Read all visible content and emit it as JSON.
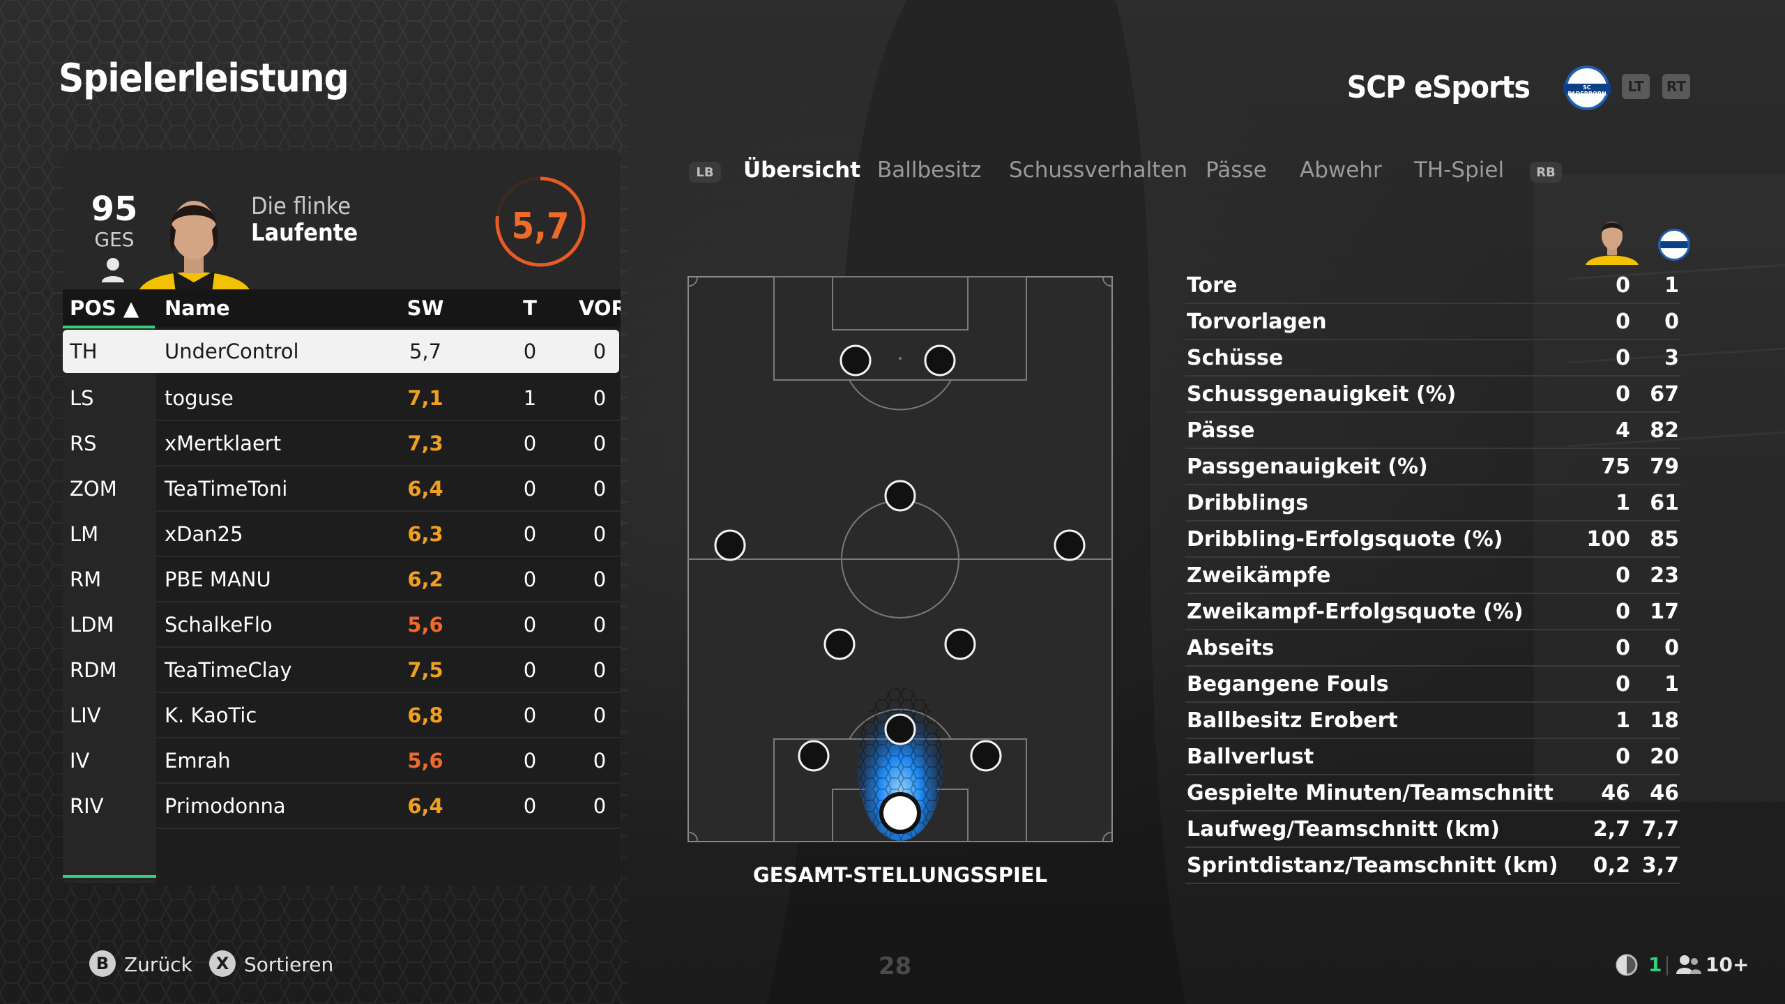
{
  "page": {
    "title": "Spielerleistung",
    "team_name": "SCP eSports",
    "page_number": "28"
  },
  "header": {
    "lt_label": "LT",
    "rt_label": "RT",
    "crest_text": "SC PADERBORN 07"
  },
  "player_card": {
    "rating": "95",
    "rating_label": "GES",
    "nickname_line1": "Die flinke",
    "nickname_line2": "Laufente",
    "match_rating": "5,7"
  },
  "table": {
    "columns": [
      "POS ▲",
      "Name",
      "SW",
      "T",
      "VOR"
    ],
    "rows": [
      {
        "pos": "TH",
        "name": "UnderControl",
        "sw": "5,7",
        "t": "0",
        "vor": "0",
        "selected": true
      },
      {
        "pos": "LS",
        "name": "toguse",
        "sw": "7,1",
        "t": "1",
        "vor": "0",
        "color": "#f0a020"
      },
      {
        "pos": "RS",
        "name": "xMertklaert",
        "sw": "7,3",
        "t": "0",
        "vor": "0",
        "color": "#f0a020"
      },
      {
        "pos": "ZOM",
        "name": "TeaTimeToni",
        "sw": "6,4",
        "t": "0",
        "vor": "0",
        "color": "#f0a020"
      },
      {
        "pos": "LM",
        "name": "xDan25",
        "sw": "6,3",
        "t": "0",
        "vor": "0",
        "color": "#f0a020"
      },
      {
        "pos": "RM",
        "name": "PBE MANU",
        "sw": "6,2",
        "t": "0",
        "vor": "0",
        "color": "#f0a020"
      },
      {
        "pos": "LDM",
        "name": "SchalkeFlo",
        "sw": "5,6",
        "t": "0",
        "vor": "0",
        "color": "#f06a2a"
      },
      {
        "pos": "RDM",
        "name": "TeaTimeClay",
        "sw": "7,5",
        "t": "0",
        "vor": "0",
        "color": "#f0a020"
      },
      {
        "pos": "LIV",
        "name": "K. KaoTic",
        "sw": "6,8",
        "t": "0",
        "vor": "0",
        "color": "#f0a020"
      },
      {
        "pos": "IV",
        "name": "Emrah",
        "sw": "5,6",
        "t": "0",
        "vor": "0",
        "color": "#f06a2a"
      },
      {
        "pos": "RIV",
        "name": "Primodonna",
        "sw": "6,4",
        "t": "0",
        "vor": "0",
        "color": "#f0a020"
      }
    ]
  },
  "tabs": {
    "lb": "LB",
    "rb": "RB",
    "items": [
      "Übersicht",
      "Ballbesitz",
      "Schussverhalten",
      "Pässe",
      "Abwehr",
      "TH-Spiel"
    ],
    "active": "Übersicht"
  },
  "pitch": {
    "label": "GESAMT-STELLUNGSSPIEL"
  },
  "stats": [
    {
      "label": "Tore",
      "player": "0",
      "team": "1"
    },
    {
      "label": "Torvorlagen",
      "player": "0",
      "team": "0"
    },
    {
      "label": "Schüsse",
      "player": "0",
      "team": "3"
    },
    {
      "label": "Schussgenauigkeit (%)",
      "player": "0",
      "team": "67"
    },
    {
      "label": "Pässe",
      "player": "4",
      "team": "82"
    },
    {
      "label": "Passgenauigkeit (%)",
      "player": "75",
      "team": "79"
    },
    {
      "label": "Dribblings",
      "player": "1",
      "team": "61"
    },
    {
      "label": "Dribbling-Erfolgsquote (%)",
      "player": "100",
      "team": "85"
    },
    {
      "label": "Zweikämpfe",
      "player": "0",
      "team": "23"
    },
    {
      "label": "Zweikampf-Erfolgsquote (%)",
      "player": "0",
      "team": "17"
    },
    {
      "label": "Abseits",
      "player": "0",
      "team": "0"
    },
    {
      "label": "Begangene Fouls",
      "player": "0",
      "team": "1"
    },
    {
      "label": "Ballbesitz Erobert",
      "player": "1",
      "team": "18"
    },
    {
      "label": "Ballverlust",
      "player": "0",
      "team": "20"
    },
    {
      "label": "Gespielte Minuten/Teamschnitt",
      "player": "46",
      "team": "46"
    },
    {
      "label": "Laufweg/Teamschnitt (km)",
      "player": "2,7",
      "team": "7,7"
    },
    {
      "label": "Sprintdistanz/Teamschnitt (km)",
      "player": "0,2",
      "team": "3,7"
    }
  ],
  "footer": {
    "back_key": "B",
    "back_label": "Zurück",
    "sort_key": "X",
    "sort_label": "Sortieren",
    "online_count": "1",
    "party_count": "10+"
  },
  "colors": {
    "accent_green": "#34d17a",
    "rating_orange": "#f06a2a",
    "good_yellow": "#f0a020",
    "heat_blue": "#1e8fff"
  }
}
